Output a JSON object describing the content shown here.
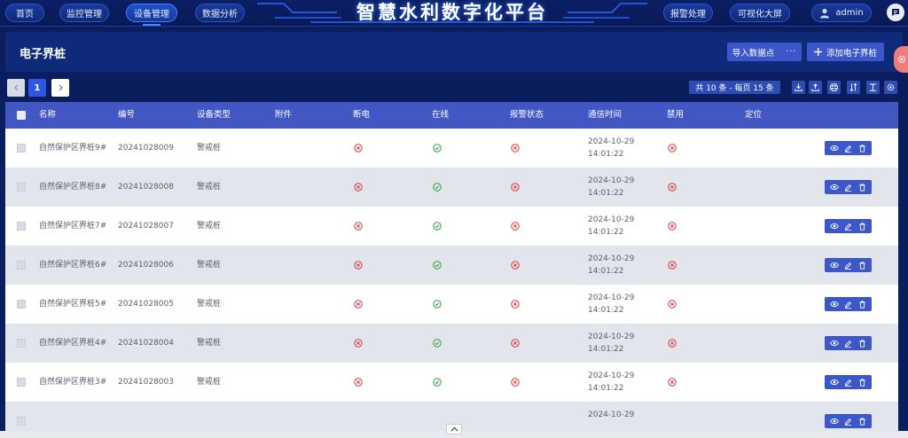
{
  "nav": {
    "left": [
      "首页",
      "监控管理",
      "设备管理",
      "数据分析"
    ],
    "active": "设备管理",
    "title": "智慧水利数字化平台",
    "right": [
      "报警处理",
      "可视化大屏"
    ],
    "user": "admin"
  },
  "header": {
    "section_title": "电子界桩",
    "import_label": "导入数据点",
    "import_more": "···",
    "add_label": "添加电子界桩",
    "add_icon": "plus-icon"
  },
  "pager": {
    "current_page": "1",
    "count_text": "共 10 条 - 每页 15 条",
    "tools": [
      "download-icon",
      "upload-icon",
      "print-icon",
      "sort-icon",
      "text-format-icon",
      "settings-icon"
    ]
  },
  "table": {
    "columns": [
      "名称",
      "编号",
      "设备类型",
      "附件",
      "断电",
      "在线",
      "报警状态",
      "通信时间",
      "禁用",
      "定位"
    ],
    "rows": [
      {
        "name": "自然保护区界桩9#",
        "code": "20241028009",
        "type": "警戒桩",
        "attachment": "",
        "power_off": "no",
        "online": "yes",
        "alarm": "no",
        "date": "2024-10-29",
        "time": "14:01:22",
        "disabled": "no",
        "location": ""
      },
      {
        "name": "自然保护区界桩8#",
        "code": "20241028008",
        "type": "警戒桩",
        "attachment": "",
        "power_off": "no",
        "online": "yes",
        "alarm": "no",
        "date": "2024-10-29",
        "time": "14:01:22",
        "disabled": "no",
        "location": ""
      },
      {
        "name": "自然保护区界桩7#",
        "code": "20241028007",
        "type": "警戒桩",
        "attachment": "",
        "power_off": "no",
        "online": "yes",
        "alarm": "no",
        "date": "2024-10-29",
        "time": "14:01:22",
        "disabled": "no",
        "location": ""
      },
      {
        "name": "自然保护区界桩6#",
        "code": "20241028006",
        "type": "警戒桩",
        "attachment": "",
        "power_off": "no",
        "online": "yes",
        "alarm": "no",
        "date": "2024-10-29",
        "time": "14:01:22",
        "disabled": "no",
        "location": ""
      },
      {
        "name": "自然保护区界桩5#",
        "code": "20241028005",
        "type": "警戒桩",
        "attachment": "",
        "power_off": "no",
        "online": "yes",
        "alarm": "no",
        "date": "2024-10-29",
        "time": "14:01:22",
        "disabled": "no",
        "location": ""
      },
      {
        "name": "自然保护区界桩4#",
        "code": "20241028004",
        "type": "警戒桩",
        "attachment": "",
        "power_off": "no",
        "online": "yes",
        "alarm": "no",
        "date": "2024-10-29",
        "time": "14:01:22",
        "disabled": "no",
        "location": ""
      },
      {
        "name": "自然保护区界桩3#",
        "code": "20241028003",
        "type": "警戒桩",
        "attachment": "",
        "power_off": "no",
        "online": "yes",
        "alarm": "no",
        "date": "2024-10-29",
        "time": "14:01:22",
        "disabled": "no",
        "location": ""
      },
      {
        "name": "",
        "code": "",
        "type": "",
        "attachment": "",
        "power_off": "",
        "online": "",
        "alarm": "",
        "date": "2024-10-29",
        "time": "",
        "disabled": "",
        "location": ""
      }
    ],
    "row_actions": [
      "view-icon",
      "edit-icon",
      "delete-icon"
    ]
  },
  "colors": {
    "nav_bg": "#0b1f66",
    "accent": "#3b57c9",
    "table_header": "#4257c4",
    "status_ok": "#2e9e3e",
    "status_bad": "#e0343c"
  }
}
